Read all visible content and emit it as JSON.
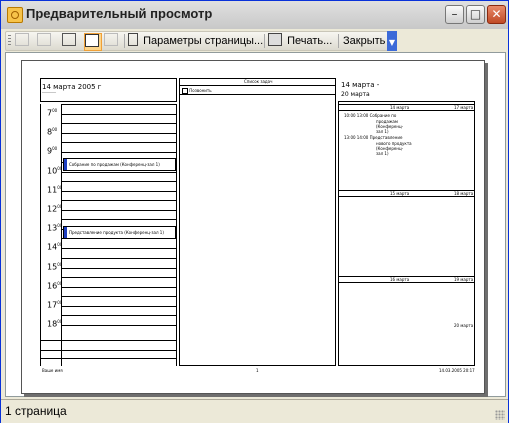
{
  "window": {
    "title": "Предварительный просмотр"
  },
  "toolbar": {
    "page_setup_label": "Параметры страницы...",
    "print_label": "Печать...",
    "close_label": "Закрыть"
  },
  "preview": {
    "left_date": "14 марта 2005 г",
    "hours": [
      "7",
      "8",
      "9",
      "10",
      "11",
      "12",
      "13",
      "14",
      "15",
      "16",
      "17",
      "18"
    ],
    "hour_suffix": "00",
    "events": [
      {
        "label": "Собрание по продажам (Конференц-зал 1)"
      },
      {
        "label": "Представление продукта (Конференц-зал 1)"
      }
    ],
    "middle_header": "Список задач",
    "middle_task": "Позвонить",
    "right_date": "14 марта -",
    "right_subdate": "20 марта",
    "right_sections": [
      {
        "left": "14 марта",
        "right": "17 марта"
      },
      {
        "left": "15 марта",
        "right": "18 марта"
      },
      {
        "left": "16 марта",
        "right": "19 марта"
      }
    ],
    "right_items": [
      "10:00 13:00 Собрание по",
      "продажам",
      "(Конференц-",
      "зал 1)",
      "13:00 14:00 Представление",
      "нового продукта",
      "(Конференц-",
      "зал 1)"
    ],
    "right_footer": "20 марта",
    "page_number": "1",
    "footer_left": "Ваше имя",
    "footer_right": "14.03.2005 20:17"
  },
  "status": {
    "pages": "1 страница"
  }
}
